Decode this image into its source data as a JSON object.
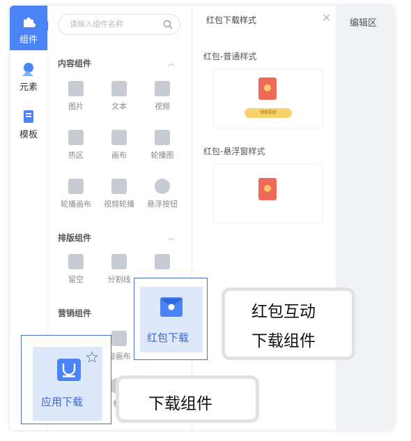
{
  "rail": {
    "items": [
      {
        "label": "组件",
        "icon": "puzzle-icon",
        "active": true
      },
      {
        "label": "元素",
        "icon": "shapes-icon",
        "active": false
      },
      {
        "label": "模板",
        "icon": "template-icon",
        "active": false
      }
    ]
  },
  "search": {
    "placeholder": "请输入组件名称",
    "icon": "search-icon"
  },
  "sections": {
    "content": {
      "title": "内容组件",
      "items": [
        {
          "label": "图片",
          "icon": "image-icon"
        },
        {
          "label": "文本",
          "icon": "text-icon"
        },
        {
          "label": "视频",
          "icon": "video-icon"
        },
        {
          "label": "热区",
          "icon": "hotspot-icon"
        },
        {
          "label": "画布",
          "icon": "canvas-icon"
        },
        {
          "label": "轮播图",
          "icon": "carousel-icon"
        },
        {
          "label": "轮播画布",
          "icon": "carousel-canvas-icon"
        },
        {
          "label": "视频轮播",
          "icon": "video-carousel-icon"
        },
        {
          "label": "悬浮按钮",
          "icon": "float-button-icon"
        }
      ]
    },
    "layout": {
      "title": "排版组件",
      "items": [
        {
          "label": "留空",
          "icon": "blank-icon"
        },
        {
          "label": "分割线",
          "icon": "divider-icon"
        },
        {
          "label": "",
          "icon": "layers-icon"
        }
      ]
    },
    "marketing": {
      "title": "营销组件",
      "items": [
        {
          "label": "",
          "icon": "marketing-icon"
        },
        {
          "label": "窗画布",
          "icon": "window-canvas-icon"
        },
        {
          "label": "标",
          "icon": "marketing-icon-2"
        }
      ]
    }
  },
  "style_panel": {
    "title": "红包下载样式",
    "styles": [
      {
        "label": "红包-普通样式",
        "button_text": "领取奖励"
      },
      {
        "label": "红包-悬浮窗样式"
      }
    ]
  },
  "edit_area": {
    "title": "编辑区"
  },
  "highlights": {
    "red_packet": {
      "label": "红包下载"
    },
    "app_download": {
      "label": "应用下载"
    }
  },
  "callouts": {
    "red_packet_line1": "红包互动",
    "red_packet_line2": "下载组件",
    "download": "下载组件"
  },
  "colors": {
    "accent": "#4a84f6",
    "highlight_border": "#4d6fbf",
    "envelope": "#f06a5a",
    "pill": "#f6d36b"
  }
}
